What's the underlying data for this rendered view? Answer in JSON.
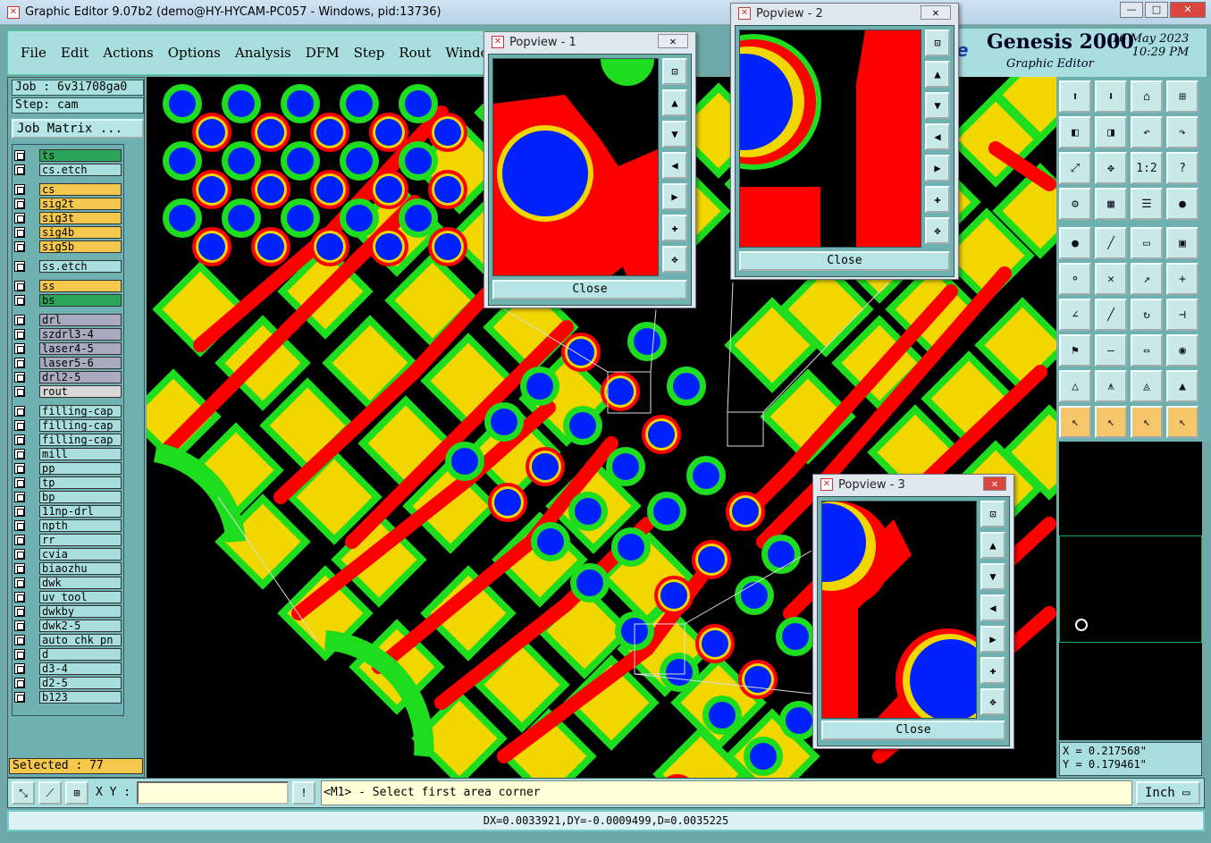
{
  "window": {
    "title": "Graphic Editor 9.07b2 (demo@HY-HYCAM-PC057 - Windows, pid:13736)"
  },
  "menu": [
    "File",
    "Edit",
    "Actions",
    "Options",
    "Analysis",
    "DFM",
    "Step",
    "Rout",
    "Windows"
  ],
  "brand": {
    "logo": "e",
    "name": "Genesis 2000",
    "subtitle": "Graphic Editor",
    "date": "16 May 2023",
    "time": "10:29 PM"
  },
  "job": {
    "job": "Job : 6v3i708ga0",
    "step": "Step: cam",
    "matrix": "Job Matrix ..."
  },
  "layers": [
    {
      "name": "ts",
      "color": "#2aa55a"
    },
    {
      "name": "cs.etch",
      "color": "#a9dede"
    },
    {
      "name": "cs",
      "color": "#f3c84c"
    },
    {
      "name": "sig2t",
      "color": "#f3c84c"
    },
    {
      "name": "sig3t",
      "color": "#f3c84c"
    },
    {
      "name": "sig4b",
      "color": "#f3c84c"
    },
    {
      "name": "sig5b",
      "color": "#f3c84c"
    },
    {
      "name": "ss.etch",
      "color": "#a9dede"
    },
    {
      "name": "ss",
      "color": "#f3c84c"
    },
    {
      "name": "bs",
      "color": "#2aa55a"
    },
    {
      "name": "drl",
      "color": "#a9a9c0"
    },
    {
      "name": "szdrl3-4",
      "color": "#a9a9c0"
    },
    {
      "name": "laser4-5",
      "color": "#a9a9c0"
    },
    {
      "name": "laser5-6",
      "color": "#a9a9c0"
    },
    {
      "name": "drl2-5",
      "color": "#a9a9c0"
    },
    {
      "name": "rout",
      "color": "#d8d8d8"
    },
    {
      "name": "filling-cap",
      "color": "#a9dede"
    },
    {
      "name": "filling-cap",
      "color": "#a9dede"
    },
    {
      "name": "filling-cap",
      "color": "#a9dede"
    },
    {
      "name": "mill",
      "color": "#a9dede"
    },
    {
      "name": "pp",
      "color": "#a9dede"
    },
    {
      "name": "tp",
      "color": "#a9dede"
    },
    {
      "name": "bp",
      "color": "#a9dede"
    },
    {
      "name": "11np-drl",
      "color": "#a9dede"
    },
    {
      "name": "npth",
      "color": "#a9dede"
    },
    {
      "name": "rr",
      "color": "#a9dede"
    },
    {
      "name": "cvia",
      "color": "#a9dede"
    },
    {
      "name": "biaozhu",
      "color": "#a9dede"
    },
    {
      "name": "dwk",
      "color": "#a9dede"
    },
    {
      "name": "uv_tool",
      "color": "#a9dede"
    },
    {
      "name": "dwkby",
      "color": "#a9dede"
    },
    {
      "name": "dwk2-5",
      "color": "#a9dede"
    },
    {
      "name": "auto_chk_pn",
      "color": "#a9dede"
    },
    {
      "name": "d",
      "color": "#a9dede"
    },
    {
      "name": "d3-4",
      "color": "#a9dede"
    },
    {
      "name": "d2-5",
      "color": "#a9dede"
    },
    {
      "name": "b123",
      "color": "#a9dede"
    }
  ],
  "selected": "Selected : 77",
  "tool_labels": {
    "ratio": "1:2"
  },
  "coords": {
    "x": "X = 0.217568\"",
    "y": "Y = 0.179461\""
  },
  "status": {
    "xy_label": "X Y :",
    "xy_value": "",
    "prompt": "<M1> - Select first area corner",
    "unit": "Inch"
  },
  "measure": "DX=0.0033921,DY=-0.0009499,D=0.0035225",
  "popviews": [
    {
      "title": "Popview - 1",
      "close": "Close"
    },
    {
      "title": "Popview - 2",
      "close": "Close"
    },
    {
      "title": "Popview - 3",
      "close": "Close"
    }
  ],
  "colors": {
    "board_black": "#000000",
    "pad_yellow": "#f2d600",
    "trace_red": "#ff0000",
    "via_blue": "#0022ff",
    "mask_green": "#1edc1e",
    "panel_teal": "#6fb0b0"
  }
}
